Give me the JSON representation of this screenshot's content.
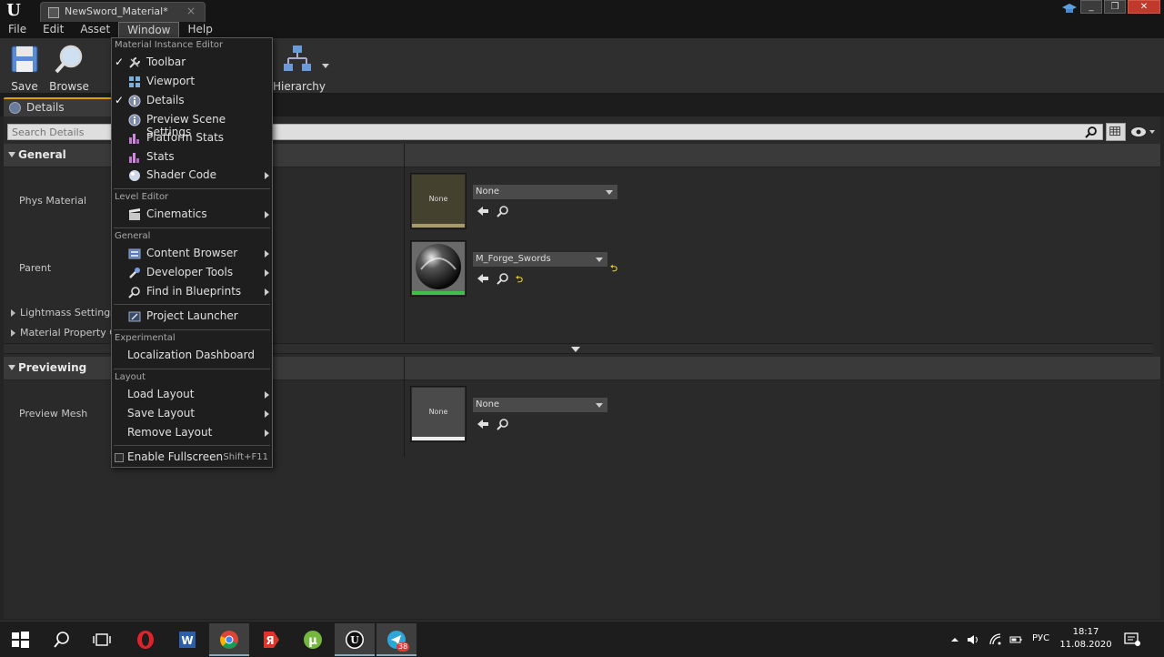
{
  "titlebar": {
    "tab_title": "NewSword_Material*",
    "tab_close": "×",
    "win_min": "_",
    "win_max": "❐",
    "win_close": "✕"
  },
  "menubar": {
    "items": [
      "File",
      "Edit",
      "Asset",
      "Window",
      "Help"
    ]
  },
  "toolbar": {
    "save_label": "Save",
    "browse_label": "Browse",
    "hierarchy_label": "Hierarchy"
  },
  "details_tab": {
    "label": "Details"
  },
  "details": {
    "search_placeholder": "Search Details",
    "categories": {
      "general": "General",
      "previewing": "Previewing"
    },
    "props": {
      "phys_material": "Phys Material",
      "parent": "Parent",
      "lightmass": "Lightmass Settings",
      "material_property": "Material Property Ove",
      "preview_mesh": "Preview Mesh"
    },
    "values": {
      "phys_material_thumb": "None",
      "phys_material_combo": "None",
      "parent_combo": "M_Forge_Swords",
      "preview_mesh_thumb": "None",
      "preview_mesh_combo": "None"
    }
  },
  "window_menu": {
    "sections": {
      "material_instance_editor": "Material Instance Editor",
      "level_editor": "Level Editor",
      "general": "General",
      "experimental": "Experimental",
      "layout": "Layout"
    },
    "items": {
      "toolbar": "Toolbar",
      "viewport": "Viewport",
      "details": "Details",
      "preview_scene_settings": "Preview Scene Settings",
      "platform_stats": "Platform Stats",
      "stats": "Stats",
      "shader_code": "Shader Code",
      "cinematics": "Cinematics",
      "content_browser": "Content Browser",
      "developer_tools": "Developer Tools",
      "find_in_blueprints": "Find in Blueprints",
      "project_launcher": "Project Launcher",
      "localization_dashboard": "Localization Dashboard",
      "load_layout": "Load Layout",
      "save_layout": "Save Layout",
      "remove_layout": "Remove Layout",
      "enable_fullscreen": "Enable Fullscreen",
      "enable_fullscreen_shortcut": "Shift+F11"
    },
    "check": "✓"
  },
  "taskbar": {
    "time": "18:17",
    "date": "11.08.2020",
    "language": "РУС",
    "telegram_badge": "38"
  },
  "colors": {
    "accent_orange": "#e0a000",
    "tex_green": "#3ec04a",
    "tex_tan": "#a89a6a"
  }
}
